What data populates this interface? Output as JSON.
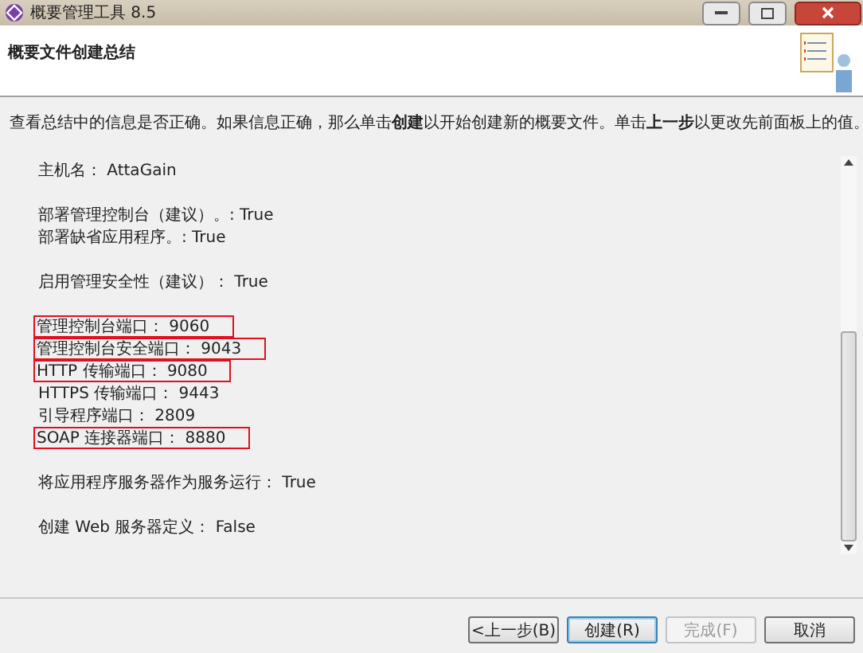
{
  "window": {
    "title": "概要管理工具 8.5"
  },
  "header": {
    "title": "概要文件创建总结"
  },
  "description": "查看总结中的信息是否正确。如果信息正确，那么单击**创建**以开始创建新的概要文件。单击**上一步**以更改先前面板上的值。",
  "summary_groups": [
    {
      "lines": [
        {
          "text": "主机名： AttaGain",
          "highlighted": false
        }
      ]
    },
    {
      "lines": [
        {
          "text": "部署管理控制台（建议）。: True",
          "highlighted": false
        },
        {
          "text": "部署缺省应用程序。: True",
          "highlighted": false
        }
      ]
    },
    {
      "lines": [
        {
          "text": "启用管理安全性（建议）： True",
          "highlighted": false
        }
      ]
    },
    {
      "lines": [
        {
          "text": "管理控制台端口： 9060",
          "highlighted": true
        },
        {
          "text": "管理控制台安全端口： 9043",
          "highlighted": true
        },
        {
          "text": "HTTP 传输端口： 9080",
          "highlighted": true
        },
        {
          "text": "HTTPS 传输端口： 9443",
          "highlighted": false
        },
        {
          "text": "引导程序端口： 2809",
          "highlighted": false
        },
        {
          "text": "SOAP 连接器端口： 8880",
          "highlighted": true
        }
      ]
    },
    {
      "lines": [
        {
          "text": "将应用程序服务器作为服务运行： True",
          "highlighted": false
        }
      ]
    },
    {
      "lines": [
        {
          "text": "创建 Web 服务器定义： False",
          "highlighted": false
        }
      ]
    }
  ],
  "buttons": [
    {
      "label": "<上一步(B)",
      "default": false,
      "disabled": false
    },
    {
      "label": "创建(R)",
      "default": true,
      "disabled": false
    },
    {
      "label": "完成(F)",
      "default": false,
      "disabled": true
    },
    {
      "label": "取消",
      "default": false,
      "disabled": false
    }
  ]
}
